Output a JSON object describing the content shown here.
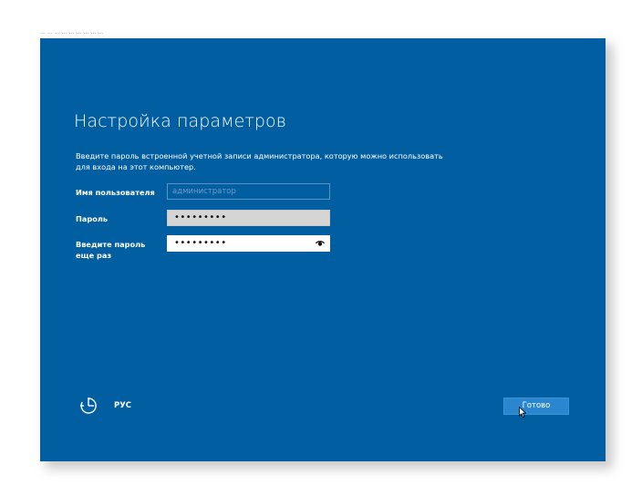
{
  "window": {
    "tiny_top_text": "…  …  …  …  …  …  …  …  …"
  },
  "page": {
    "title": "Настройка параметров",
    "intro": "Введите пароль встроенной учетной записи администратора, которую можно использовать для входа на этот компьютер."
  },
  "form": {
    "username_label": "Имя пользователя",
    "username_placeholder": "администратор",
    "password_label": "Пароль",
    "password_value": "•••••••••",
    "password_repeat_label": "Введите пароль еще раз",
    "password_repeat_value": "•••••••••"
  },
  "footer": {
    "ease_icon": "ease-of-access-icon",
    "language": "РУС",
    "done_label": "Готово"
  },
  "colors": {
    "background": "#015ea0",
    "button": "#2b86d0",
    "text": "#ffffff"
  }
}
